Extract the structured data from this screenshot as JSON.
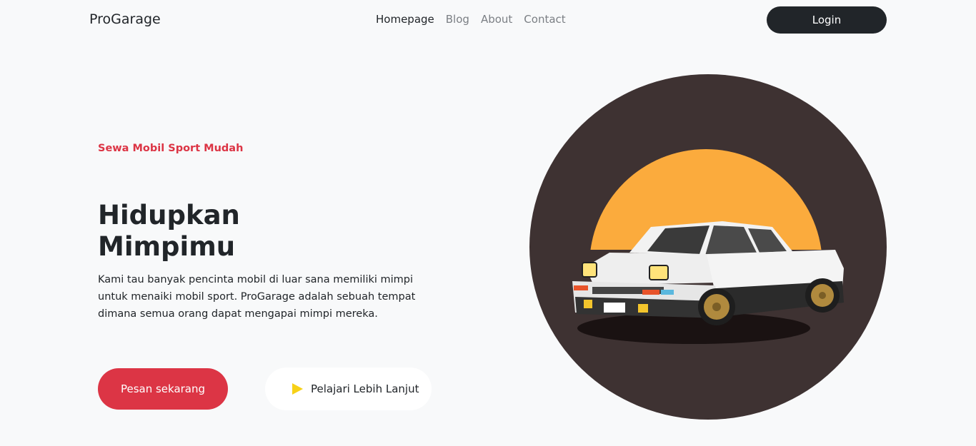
{
  "navbar": {
    "brand": "ProGarage",
    "links": [
      {
        "label": "Homepage",
        "active": true
      },
      {
        "label": "Blog",
        "active": false
      },
      {
        "label": "About",
        "active": false
      },
      {
        "label": "Contact",
        "active": false
      }
    ],
    "login_label": "Login"
  },
  "hero": {
    "eyebrow": "Sewa Mobil Sport Mudah",
    "headline_line1": "Hidupkan",
    "headline_line2": "Mimpimu",
    "description": "Kami tau banyak pencinta mobil di luar sana memiliki mimpi untuk menaiki mobil sport. ProGarage adalah sebuah tempat dimana semua orang dapat mengapai mimpi mereka.",
    "primary_cta": "Pesan sekarang",
    "secondary_cta": "Pelajari Lebih Lanjut",
    "secondary_icon": "play-icon",
    "illustration": "white sports car in front of orange sun on dark circle"
  },
  "colors": {
    "accent": "#dc3545",
    "dark": "#212529",
    "background": "#f8f9fa",
    "circle": "#3e3232",
    "sun": "#fbab3d",
    "play": "#f7d117"
  }
}
